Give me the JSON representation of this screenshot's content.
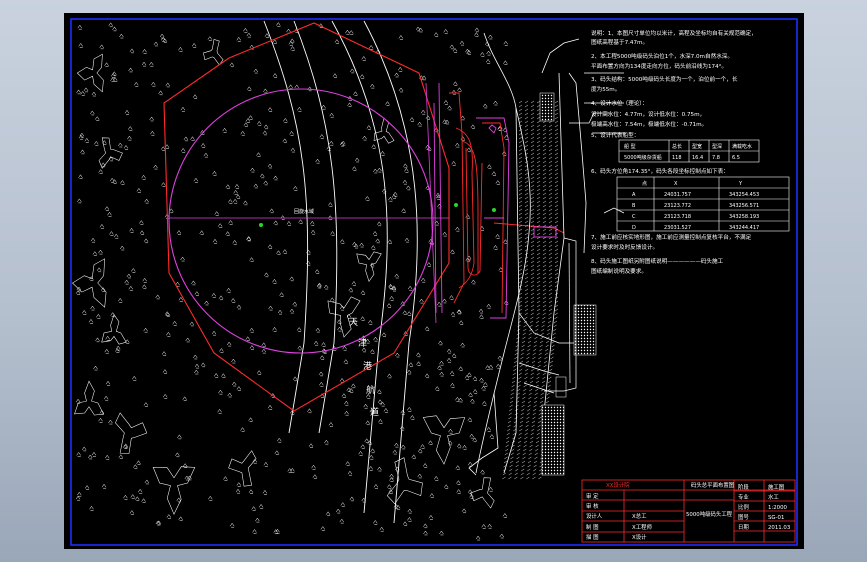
{
  "channel_label": [
    "天",
    "津",
    "港",
    "航",
    "道"
  ],
  "circle_label": "回旋水域",
  "notes": [
    "说明：1、本图尺寸单位均以米计，高程及坐标均自有关规范确定，",
    "      图纸高程基于7.47m。",
    "2、本工程5000吨级码头泊位1个，水深7.0m自然水深。",
    "   平面布置方向为134度走向方位，码头前沿线为174°。",
    "3、码头结构：5000吨级码头长度为一个，泊位前一个，长",
    "   度为55m。",
    "4、设计水位（理论）：",
    "   设计高水位：4.77m，设计低水位：0.75m，",
    "   极端高水位：7.54m，极端低水位：-0.71m。",
    "5、设计代表船型：",
    "6、码头方位角174.35°，码头各段坐标控制点如下表：",
    "7、施工前应核实地形图，施工前应测量控制点复核平台，不满足",
    "   设计要求时及时反馈设计。",
    "8、码头施工图纸另附图纸说明——————码头施工",
    "   图纸编制说明及要求。"
  ],
  "ship_table": {
    "headers": [
      "船  型",
      "总长",
      "型宽",
      "型深",
      "满载吃水"
    ],
    "row": [
      "5000吨级杂货船",
      "118",
      "16.4",
      "7.8",
      "6.5"
    ]
  },
  "coord_table": {
    "headers": [
      "点",
      "X",
      "Y"
    ],
    "rows": [
      [
        "A",
        "24031.757",
        "343254.453"
      ],
      [
        "B",
        "23123.772",
        "343256.571"
      ],
      [
        "C",
        "23123.718",
        "343258.193"
      ],
      [
        "D",
        "23031.527",
        "343244.417"
      ]
    ]
  },
  "title_block": {
    "org": "XX设计院",
    "drawing_title": "码头总平面布置图",
    "sub_title": "5000吨级码头工程",
    "left_labels": [
      "审  定",
      "审  核",
      "设计人",
      "制  图",
      "描  图"
    ],
    "left_values": [
      "",
      "",
      "X总工",
      "X工程师",
      "X设计"
    ],
    "right_labels": [
      "阶段",
      "专业",
      "比例",
      "图号",
      "日期"
    ],
    "right_values": [
      "施工图",
      "水工",
      "1:2000",
      "SG-01",
      "2011.03"
    ]
  }
}
